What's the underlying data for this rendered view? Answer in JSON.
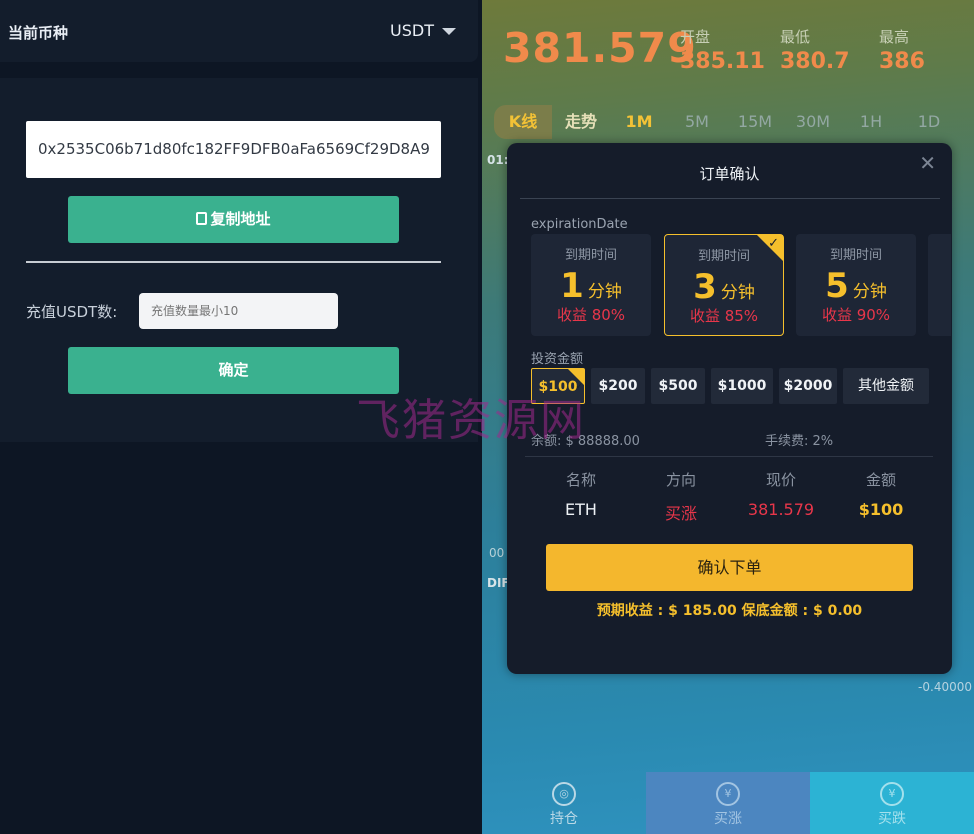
{
  "left": {
    "header_title": "当前币种",
    "currency": "USDT",
    "address": "0x2535C06b71d80fc182FF9DFB0aFa6569Cf29D8A9",
    "copy_label": "复制地址",
    "amount_label": "充值USDT数:",
    "amount_placeholder": "充值数量最小10",
    "confirm_label": "确定"
  },
  "market": {
    "price": "381.579",
    "open_label": "开盘",
    "open_value": "385.11",
    "low_label": "最低",
    "low_value": "380.7",
    "high_label": "最高",
    "high_value": "386",
    "tabs": [
      "K线",
      "走势",
      "1M",
      "5M",
      "15M",
      "30M",
      "1H",
      "1D"
    ],
    "side_time": "01:",
    "side_00": "00",
    "side_dif": "DIF",
    "axis_value": "-0.40000"
  },
  "bottom_nav": {
    "hold": "持仓",
    "buy_up": "买涨",
    "buy_down": "买跌"
  },
  "modal": {
    "title": "订单确认",
    "expiration_label": "expirationDate",
    "cards": [
      {
        "label": "到期时间",
        "num": "1",
        "unit": "分钟",
        "profit": "收益 80%"
      },
      {
        "label": "到期时间",
        "num": "3",
        "unit": "分钟",
        "profit": "收益 85%"
      },
      {
        "label": "到期时间",
        "num": "5",
        "unit": "分钟",
        "profit": "收益 90%"
      }
    ],
    "invest_label": "投资金额",
    "amounts": [
      "$100",
      "$200",
      "$500",
      "$1000",
      "$2000",
      "其他金额"
    ],
    "balance": "余额: $ 88888.00",
    "fee": "手续费: 2%",
    "headers": [
      "名称",
      "方向",
      "现价",
      "金额"
    ],
    "row": [
      "ETH",
      "买涨",
      "381.579",
      "$100"
    ],
    "confirm_label": "确认下单",
    "expect_text": "预期收益 : $ 185.00    保底金额 : $ 0.00"
  },
  "watermark": "飞猪资源网",
  "colors": {
    "accent_green": "#3ab18f",
    "accent_gold": "#f5bf2c",
    "price_orange": "#f08a4b",
    "red": "#e8364a"
  }
}
